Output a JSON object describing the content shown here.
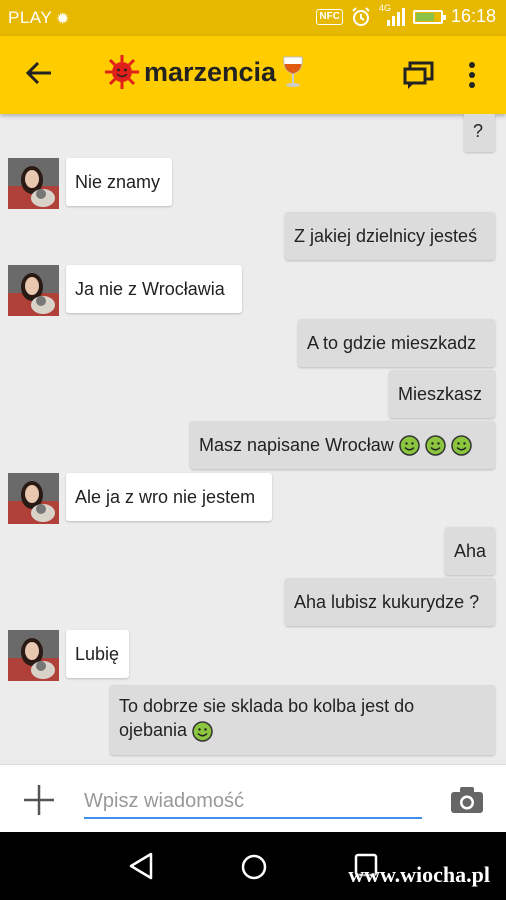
{
  "status_bar": {
    "carrier": "PLAY",
    "network": "4G",
    "nfc": "NFC",
    "time": "16:18"
  },
  "app_bar": {
    "contact_name": "marzencia"
  },
  "messages": [
    {
      "dir": "out",
      "text": "?"
    },
    {
      "dir": "in",
      "text": "Nie znamy"
    },
    {
      "dir": "out",
      "text": "Z jakiej dzielnicy jesteś"
    },
    {
      "dir": "in",
      "text": "Ja nie z Wrocławia"
    },
    {
      "dir": "out",
      "text": "A to gdzie mieszkadz"
    },
    {
      "dir": "out",
      "text": "Mieszkasz"
    },
    {
      "dir": "out",
      "text": "Masz napisane Wrocław",
      "emoji": "smiley-icon x3"
    },
    {
      "dir": "in",
      "text": "Ale ja z wro nie jestem"
    },
    {
      "dir": "out",
      "text": "Aha"
    },
    {
      "dir": "out",
      "text": "Aha lubisz kukurydze ?"
    },
    {
      "dir": "in",
      "text": "Lubię"
    },
    {
      "dir": "out",
      "text": "To dobrze sie sklada bo kolba jest do ojebania",
      "emoji": "smiley-icon"
    }
  ],
  "composer": {
    "placeholder": "Wpisz wiadomość"
  },
  "watermark": "www.wiocha.pl",
  "colors": {
    "app_bar": "#ffcc00",
    "status_bar": "#e6b800",
    "outgoing_bubble": "#dcdcdc",
    "incoming_bubble": "#ffffff",
    "input_underline": "#3f8ee8"
  }
}
